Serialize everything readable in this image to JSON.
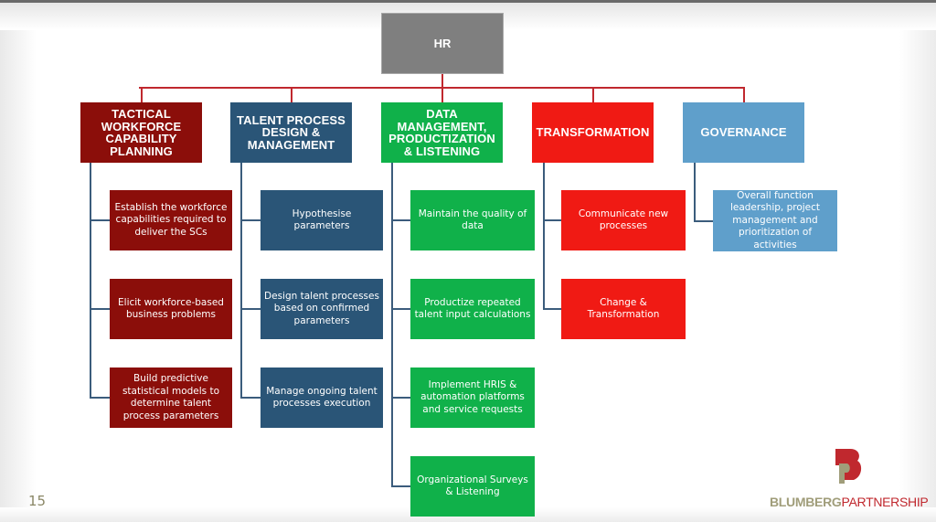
{
  "slide": {
    "page_number": "15",
    "logo": {
      "part1": "BLUMBERG",
      "part2": "PARTNERSHIP",
      "mark_letter": "B"
    }
  },
  "root": {
    "label": "HR",
    "color": "#7f7f7f"
  },
  "colors": {
    "connector_top": "#c0282e",
    "connector_branch": "#3b5c7c"
  },
  "branches": [
    {
      "label": "TACTICAL WORKFORCE CAPABILITY PLANNING",
      "lines": [
        "TACTICAL",
        "WORKFORCE",
        "CAPABILITY",
        "PLANNING"
      ],
      "color": "#8b0e0a",
      "children": [
        "Establish the workforce capabilities required to deliver the SCs",
        "Elicit workforce-based business problems",
        "Build predictive statistical models to determine talent process parameters"
      ]
    },
    {
      "label": "TALENT PROCESS DESIGN & MANAGEMENT",
      "lines": [
        "TALENT PROCESS",
        "DESIGN &",
        "MANAGEMENT"
      ],
      "color": "#2a5577",
      "children": [
        "Hypothesise parameters",
        "Design talent processes based on confirmed parameters",
        "Manage ongoing talent processes execution"
      ]
    },
    {
      "label": "DATA MANAGEMENT, PRODUCTIZATION & LISTENING",
      "lines": [
        "DATA",
        "MANAGEMENT,",
        "PRODUCTIZATION",
        "& LISTENING"
      ],
      "color": "#10b14a",
      "children": [
        "Maintain the quality of data",
        "Productize repeated talent input calculations",
        "Implement HRIS & automation platforms and service requests",
        "Organizational Surveys & Listening"
      ]
    },
    {
      "label": "TRANSFORMATION",
      "lines": [
        "TRANSFORMATION"
      ],
      "color": "#f01a14",
      "children": [
        "Communicate new processes",
        "Change & Transformation"
      ]
    },
    {
      "label": "GOVERNANCE",
      "lines": [
        "GOVERNANCE"
      ],
      "color": "#5f9fcb",
      "children": [
        "Overall function leadership, project management and prioritization of activities"
      ]
    }
  ]
}
